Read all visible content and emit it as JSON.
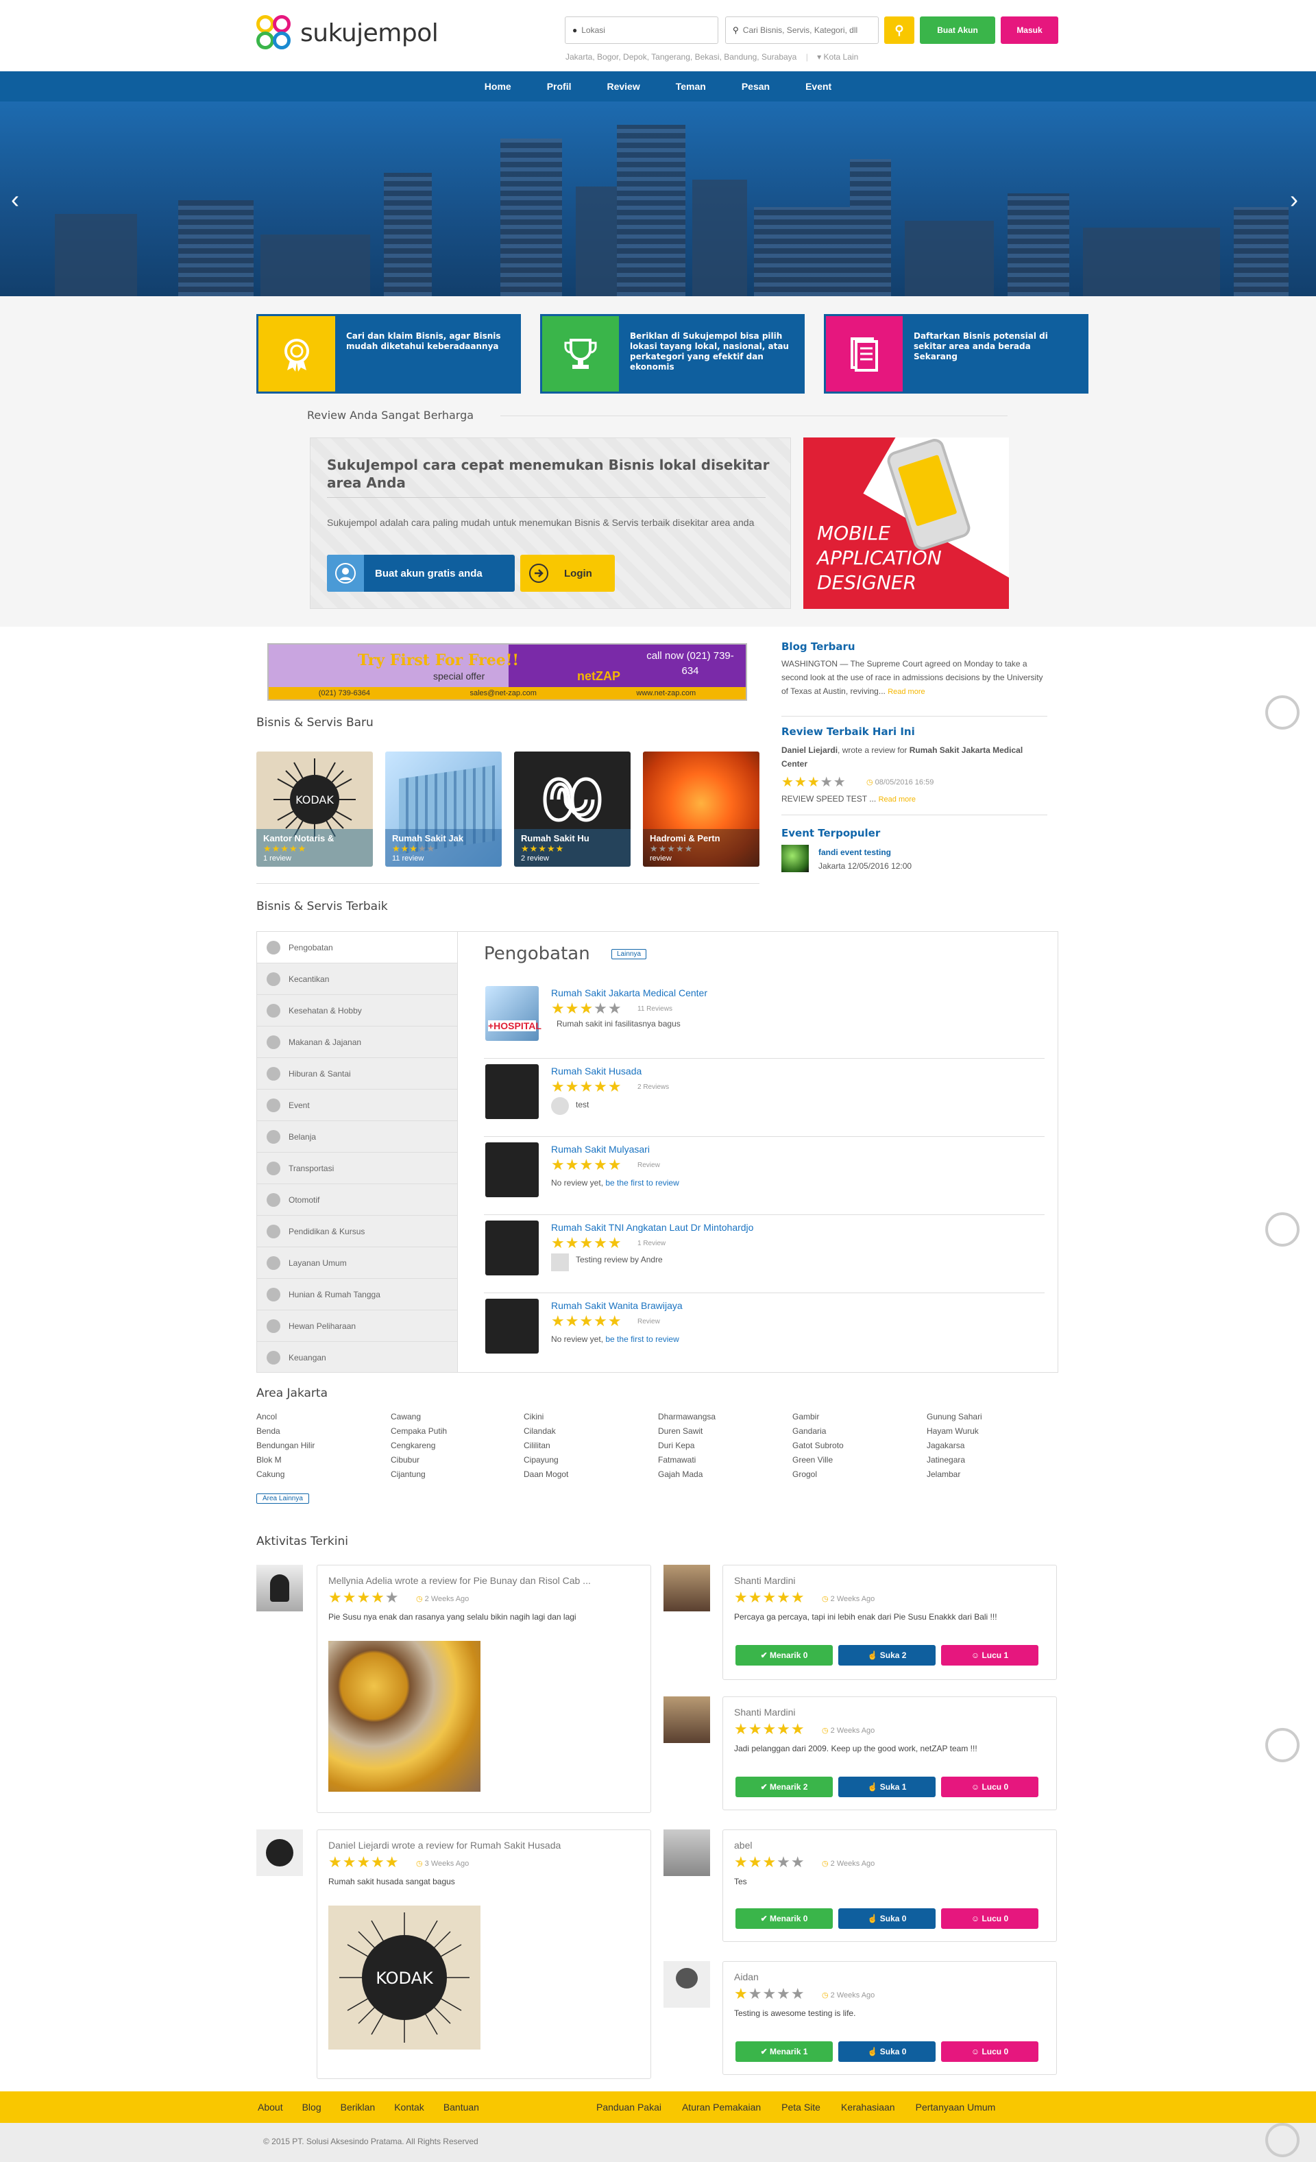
{
  "brand": {
    "name": "sukujempol"
  },
  "header": {
    "location_placeholder": "Lokasi",
    "search_placeholder": "Cari Bisnis, Servis, Kategori, dll",
    "create_account": "Buat Akun",
    "login": "Masuk",
    "cities": "Jakarta, Bogor, Depok, Tangerang, Bekasi, Bandung, Surabaya",
    "other_city": "Kota Lain"
  },
  "nav": [
    "Home",
    "Profil",
    "Review",
    "Teman",
    "Pesan",
    "Event"
  ],
  "features": [
    {
      "text": "Cari dan klaim Bisnis, agar Bisnis mudah diketahui keberadaannya",
      "icon": "badge-icon",
      "color": "#f9c700"
    },
    {
      "text": "Beriklan di Sukujempol bisa pilih lokasi tayang lokal, nasional, atau perkategori yang efektif dan ekonomis",
      "icon": "trophy-icon",
      "color": "#3ab54a"
    },
    {
      "text": "Daftarkan Bisnis potensial di sekitar area anda berada Sekarang",
      "icon": "document-icon",
      "color": "#e6177e"
    }
  ],
  "review_section_title": "Review Anda Sangat Berharga",
  "promo": {
    "title": "SukuJempol cara cepat menemukan Bisnis lokal disekitar area Anda",
    "desc": "Sukujempol adalah cara paling mudah untuk menemukan Bisnis & Servis terbaik disekitar area anda",
    "create_free": "Buat akun gratis anda",
    "login": "Login"
  },
  "mobile_ad": {
    "line1": "MOBILE",
    "line2": "APPLICATION",
    "line3": "DESIGNER"
  },
  "ad_banner": {
    "headline": "Try First For Free!!",
    "sub": "special offer",
    "phone": "call now (021) 739-634",
    "brand": "netZAP",
    "phone2": "(021) 739-6364",
    "email": "sales@net-zap.com",
    "site": "www.net-zap.com"
  },
  "new_business": {
    "title": "Bisnis & Servis Baru",
    "items": [
      {
        "name": "Kantor Notaris &",
        "reviews": "1 review",
        "stars": 5,
        "img": "kodak"
      },
      {
        "name": "Rumah Sakit Jak",
        "reviews": "11 review",
        "stars": 3,
        "img": "hospital"
      },
      {
        "name": "Rumah Sakit Hu",
        "reviews": "2 review",
        "stars": 5,
        "img": "swirl"
      },
      {
        "name": "Hadromi & Pertn",
        "reviews": "review",
        "stars": 0,
        "img": "flower"
      }
    ]
  },
  "blog": {
    "title": "Blog Terbaru",
    "text": "WASHINGTON — The Supreme Court agreed on Monday to take a second look at the use of race in admissions decisions by the University of Texas at Austin, reviving...",
    "read_more": "Read more"
  },
  "review_today": {
    "title": "Review Terbaik Hari Ini",
    "author": "Daniel Liejardi",
    "action": "wrote a review for",
    "target": "Rumah Sakit Jakarta Medical Center",
    "stars": 3,
    "date": "08/05/2016 16:59",
    "text": "REVIEW SPEED TEST ...",
    "read_more": "Read more"
  },
  "event": {
    "title": "Event Terpopuler",
    "name": "fandi event testing",
    "meta": "Jakarta 12/05/2016 12:00"
  },
  "best": {
    "title": "Bisnis & Servis Terbaik",
    "active": "Pengobatan",
    "more": "Lainnya",
    "categories": [
      "Pengobatan",
      "Kecantikan",
      "Kesehatan & Hobby",
      "Makanan & Jajanan",
      "Hiburan & Santai",
      "Event",
      "Belanja",
      "Transportasi",
      "Otomotif",
      "Pendidikan & Kursus",
      "Layanan Umum",
      "Hunian & Rumah Tangga",
      "Hewan Peliharaan",
      "Keuangan"
    ],
    "listings": [
      {
        "name": "Rumah Sakit Jakarta Medical Center",
        "stars": 3,
        "count": "11 Reviews",
        "text": "Rumah sakit ini fasilitasnya bagus",
        "img": "hospital",
        "link": ""
      },
      {
        "name": "Rumah Sakit Husada",
        "stars": 5,
        "count": "2 Reviews",
        "text": "test",
        "img": "swirl",
        "link": ""
      },
      {
        "name": "Rumah Sakit Mulyasari",
        "stars": 5,
        "count": "Review",
        "text": "No review yet,",
        "img": "swirl",
        "link": "be the first to review"
      },
      {
        "name": "Rumah Sakit TNI Angkatan Laut Dr Mintohardjo",
        "stars": 5,
        "count": "1 Review",
        "text": "Testing review by Andre",
        "img": "swirl",
        "link": ""
      },
      {
        "name": "Rumah Sakit Wanita Brawijaya",
        "stars": 5,
        "count": "Review",
        "text": "No review yet,",
        "img": "swirl",
        "link": "be the first to review"
      }
    ]
  },
  "area": {
    "title": "Area Jakarta",
    "more": "Area Lainnya",
    "columns": [
      [
        "Ancol",
        "Benda",
        "Bendungan Hilir",
        "Blok M",
        "Cakung"
      ],
      [
        "Cawang",
        "Cempaka Putih",
        "Cengkareng",
        "Cibubur",
        "Cijantung"
      ],
      [
        "Cikini",
        "Cilandak",
        "Cililitan",
        "Cipayung",
        "Daan Mogot"
      ],
      [
        "Dharmawangsa",
        "Duren Sawit",
        "Duri Kepa",
        "Fatmawati",
        "Gajah Mada"
      ],
      [
        "Gambir",
        "Gandaria",
        "Gatot Subroto",
        "Green Ville",
        "Grogol"
      ],
      [
        "Gunung Sahari",
        "Hayam Wuruk",
        "Jagakarsa",
        "Jatinegara",
        "Jelambar"
      ]
    ]
  },
  "activity": {
    "title": "Aktivitas Terkini",
    "left": [
      {
        "who": "Mellynia Adelia wrote a review for Pie Bunay dan Risol Cab ...",
        "stars": 4,
        "time": "2 Weeks Ago",
        "text": "Pie Susu nya enak dan rasanya yang selalu bikin nagih lagi dan lagi"
      },
      {
        "who": "Daniel Liejardi wrote a review for Rumah Sakit Husada",
        "stars": 5,
        "time": "3 Weeks Ago",
        "text": "Rumah sakit husada sangat bagus"
      }
    ],
    "right": [
      {
        "who": "Shanti Mardini",
        "stars": 5,
        "time": "2 Weeks Ago",
        "text": "Percaya ga percaya, tapi ini lebih enak dari Pie Susu Enakkk dari Bali !!!",
        "menarik": "Menarik 0",
        "suka": "Suka 2",
        "lucu": "Lucu 1"
      },
      {
        "who": "Shanti Mardini",
        "stars": 5,
        "time": "2 Weeks Ago",
        "text": "Jadi pelanggan dari 2009. Keep up the good work, netZAP team !!!",
        "menarik": "Menarik 2",
        "suka": "Suka 1",
        "lucu": "Lucu 0"
      },
      {
        "who": "abel",
        "stars": 3,
        "time": "2 Weeks Ago",
        "text": "Tes",
        "menarik": "Menarik 0",
        "suka": "Suka 0",
        "lucu": "Lucu 0"
      },
      {
        "who": "Aidan",
        "stars": 1,
        "time": "2 Weeks Ago",
        "text": "Testing is awesome testing is life.",
        "menarik": "Menarik 1",
        "suka": "Suka 0",
        "lucu": "Lucu 0"
      }
    ]
  },
  "footer": {
    "left": [
      "About",
      "Blog",
      "Beriklan",
      "Kontak",
      "Bantuan"
    ],
    "right": [
      "Panduan Pakai",
      "Aturan Pemakaian",
      "Peta Site",
      "Kerahasiaan",
      "Pertanyaan Umum"
    ],
    "copyright": "© 2015 PT. Solusi Aksesindo Pratama. All Rights Reserved"
  },
  "colors": {
    "blue": "#0f5f9e",
    "green": "#3ab54a",
    "pink": "#e6177e",
    "yellow": "#f9c700"
  }
}
